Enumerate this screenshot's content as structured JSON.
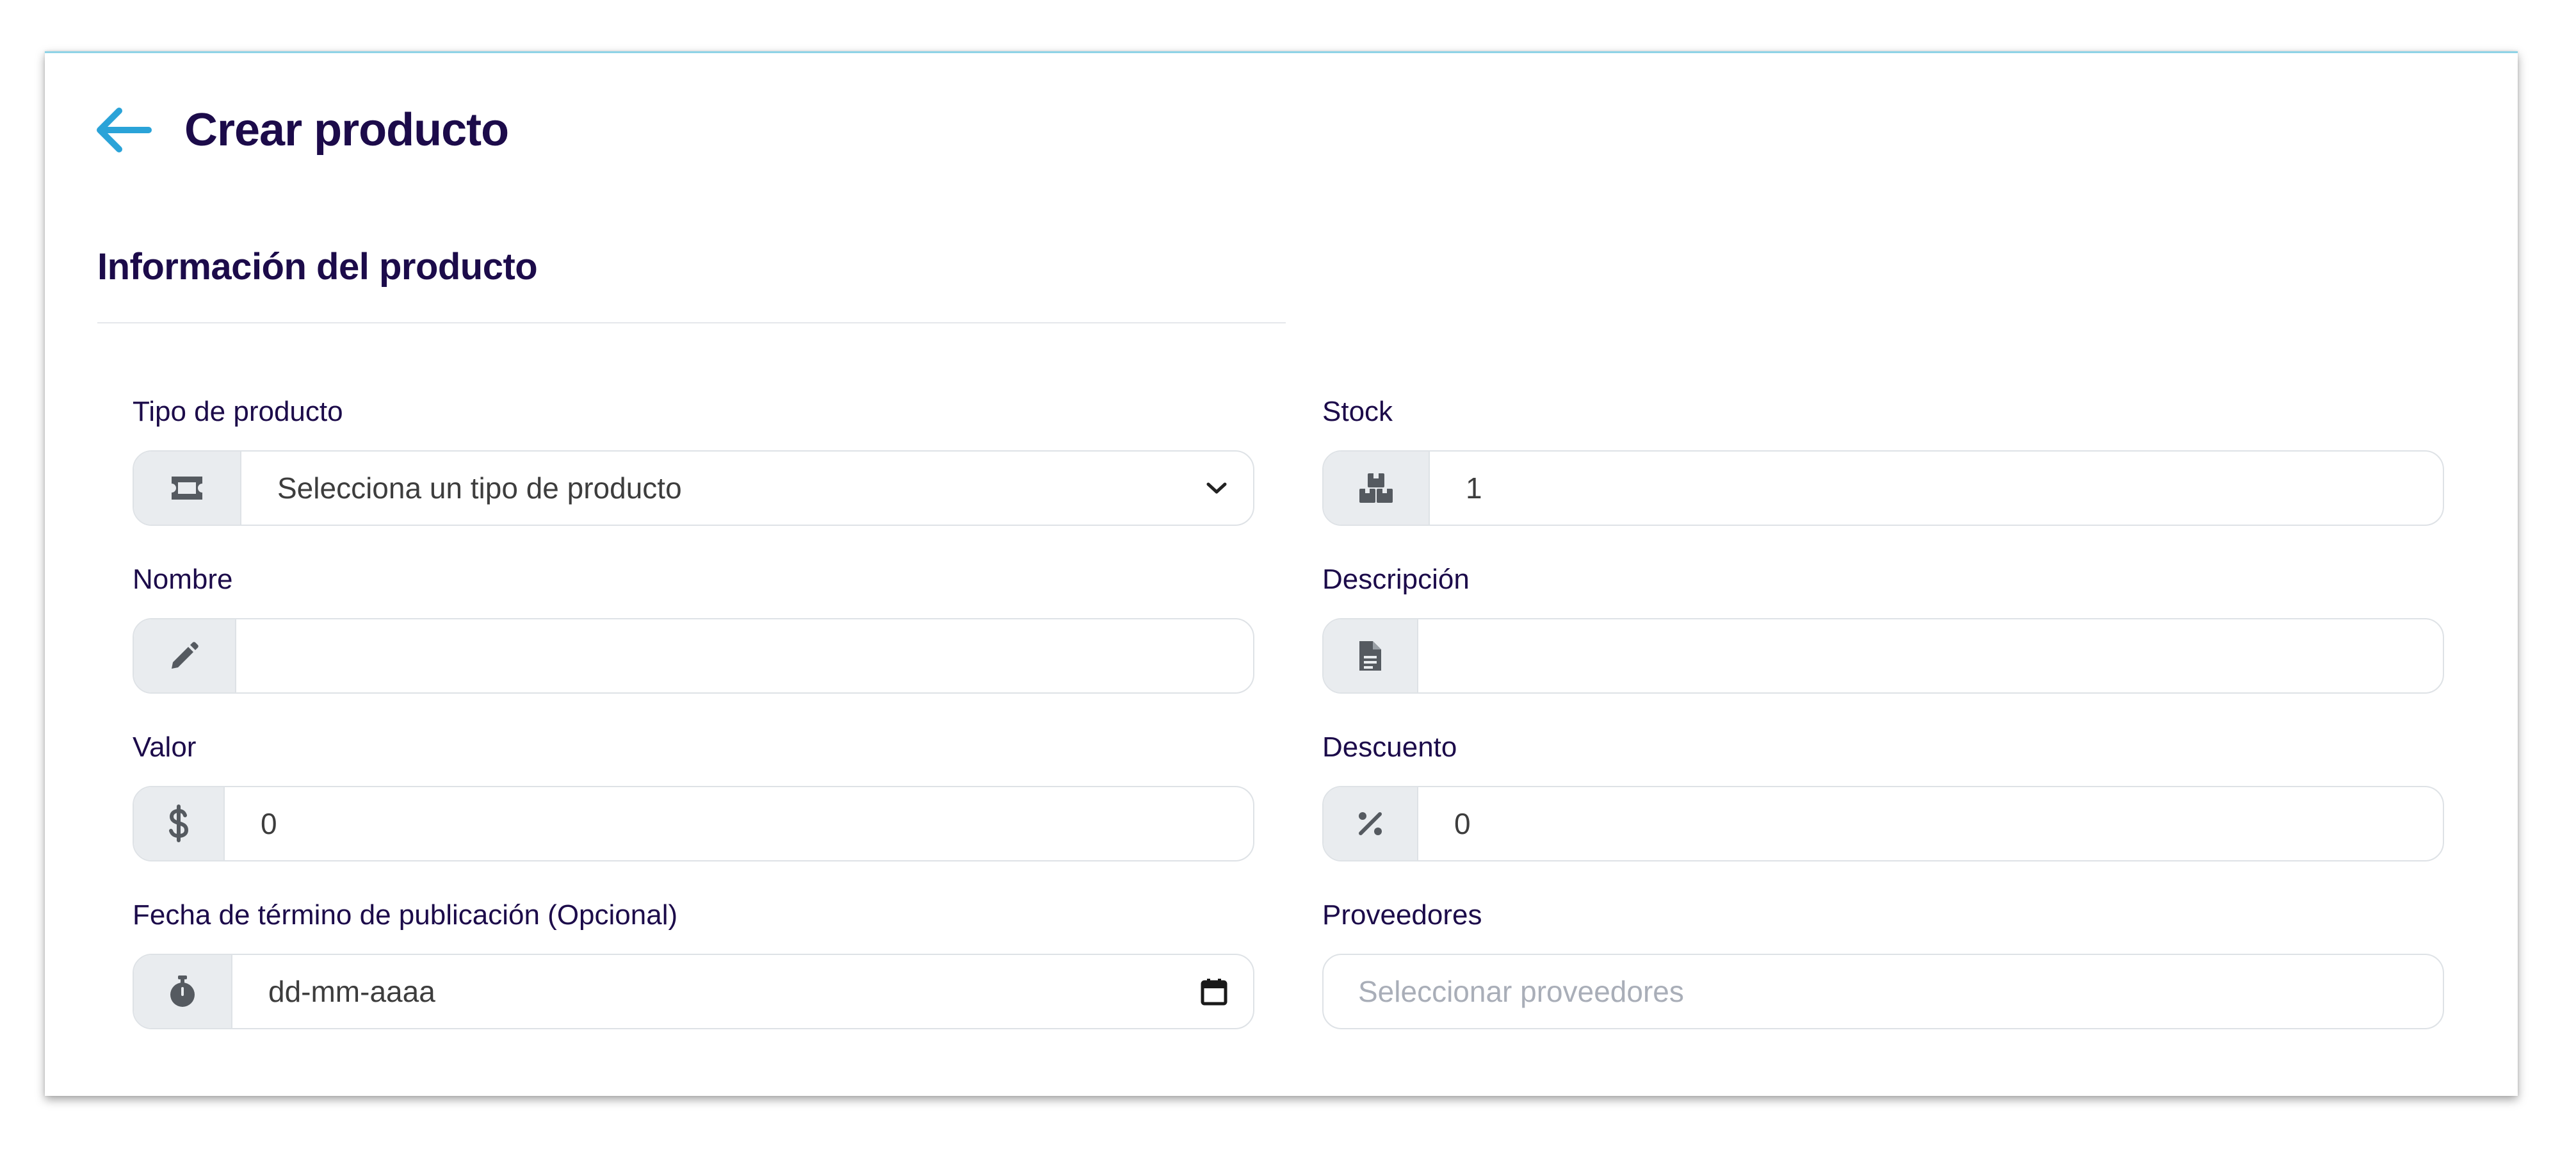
{
  "page": {
    "title": "Crear producto",
    "back_icon": "arrow-left-icon",
    "accent_color": "#2aa3d8",
    "title_color": "#1c0b4a"
  },
  "section": {
    "title": "Información del producto"
  },
  "fields": {
    "product_type": {
      "label": "Tipo de producto",
      "icon": "ticket-icon",
      "selected_value": "Selecciona un tipo de producto"
    },
    "stock": {
      "label": "Stock",
      "icon": "boxes-icon",
      "value": "1"
    },
    "name": {
      "label": "Nombre",
      "icon": "pencil-icon",
      "value": ""
    },
    "description": {
      "label": "Descripción",
      "icon": "file-icon",
      "value": ""
    },
    "price": {
      "label": "Valor",
      "icon": "dollar-icon",
      "value": "0"
    },
    "discount": {
      "label": "Descuento",
      "icon": "percent-icon",
      "value": "0"
    },
    "end_date": {
      "label": "Fecha de término de publicación (Opcional)",
      "icon": "stopwatch-icon",
      "placeholder": "dd-mm-aaaa"
    },
    "suppliers": {
      "label": "Proveedores",
      "placeholder": "Seleccionar proveedores"
    }
  }
}
